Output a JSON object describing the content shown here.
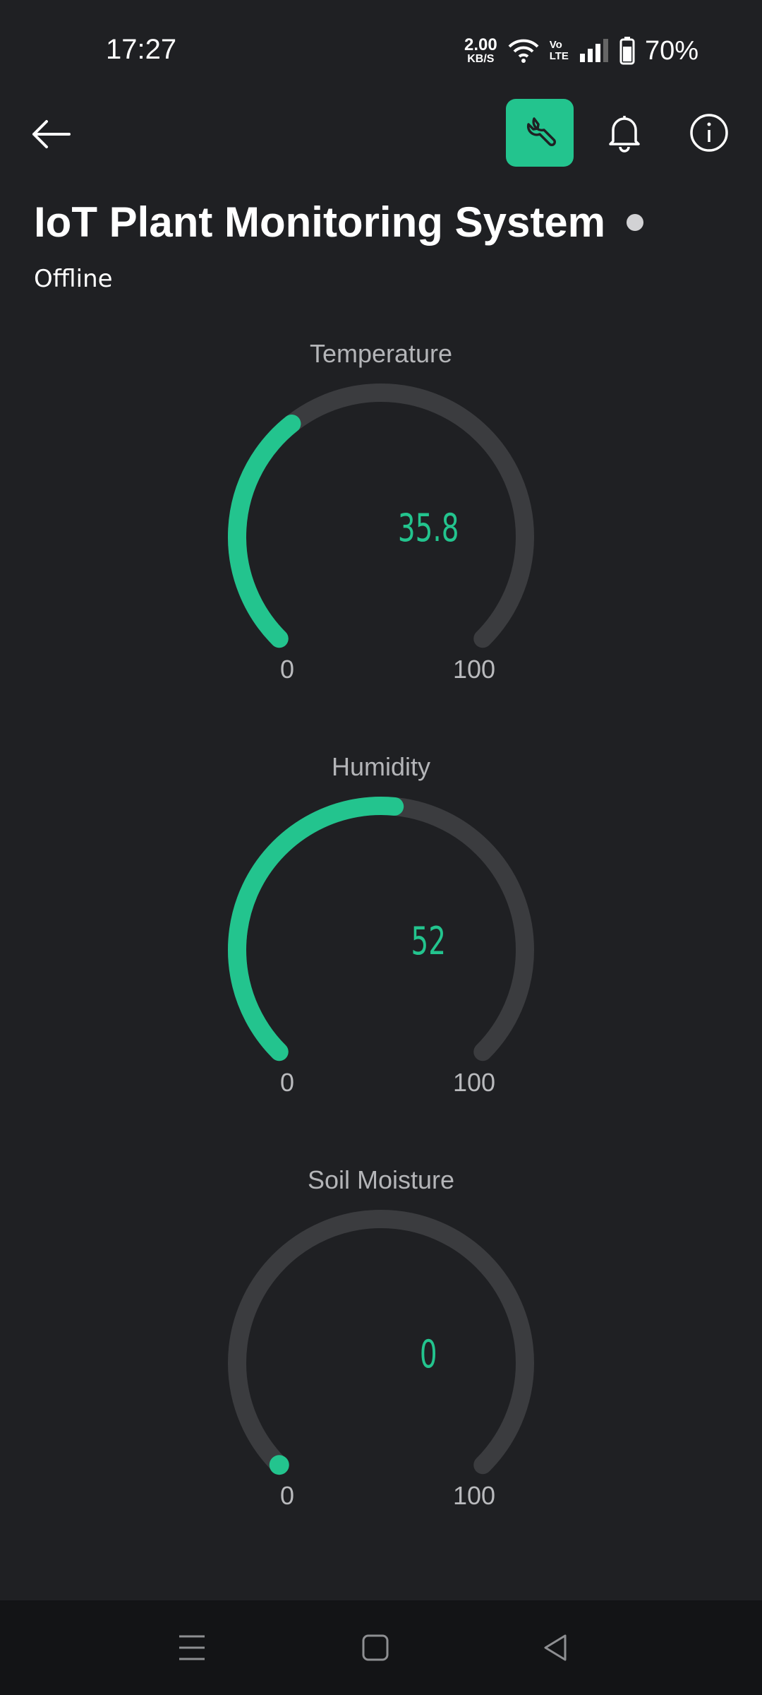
{
  "status_bar": {
    "time": "17:27",
    "net_speed_value": "2.00",
    "net_speed_unit": "KB/S",
    "volte_top": "Vo",
    "volte_bottom": "LTE",
    "battery": "70%"
  },
  "toolbar": {
    "back_icon": "arrow-left-icon",
    "settings_icon": "wrench-icon",
    "notifications_icon": "bell-icon",
    "info_icon": "info-icon",
    "accent_color": "#23c48e"
  },
  "header": {
    "title": "IoT Plant Monitoring System",
    "status": "Offline"
  },
  "gauges": [
    {
      "label": "Temperature",
      "value": "35.8",
      "value_num": 35.8,
      "min": "0",
      "max": "100"
    },
    {
      "label": "Humidity",
      "value": "52",
      "value_num": 52,
      "min": "0",
      "max": "100"
    },
    {
      "label": "Soil Moisture",
      "value": "0",
      "value_num": 0,
      "min": "0",
      "max": "100"
    }
  ],
  "nav_bar": {
    "menu_icon": "menu-icon",
    "home_icon": "home-square-icon",
    "back_icon": "back-triangle-icon"
  }
}
